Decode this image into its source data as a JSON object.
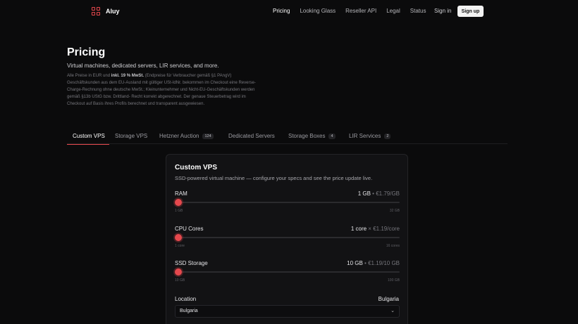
{
  "header": {
    "brand": "Aluy",
    "nav": [
      "Pricing",
      "Looking Glass",
      "Reseller API",
      "Legal",
      "Status"
    ],
    "active_nav": "Pricing",
    "signin": "Sign in",
    "signup": "Sign up"
  },
  "hero": {
    "title": "Pricing",
    "subtitle": "Virtual machines, dedicated servers, LIR services, and more.",
    "vat_prefix": "Alle Preise in EUR und ",
    "vat_bold": "inkl. 19 % MwSt.",
    "vat_rest": " (Endpreise für Verbraucher gemäß §1 PAngV) Geschäftskunden aus dem EU-Ausland mit gültiger USt-IdNr. bekommen im Checkout eine Reverse-Charge-Rechnung ohne deutsche MwSt.; Kleinunternehmer und Nicht-EU-Geschäftskunden werden gemäß §13b UStG bzw. Drittland- Recht korrekt abgerechnet. Der genaue Steuerbetrag wird im Checkout auf Basis ihres Profils berechnet und transparent ausgewiesen."
  },
  "tabs": [
    {
      "label": "Custom VPS",
      "count": ""
    },
    {
      "label": "Storage VPS",
      "count": ""
    },
    {
      "label": "Hetzner Auction",
      "count": "124"
    },
    {
      "label": "Dedicated Servers",
      "count": ""
    },
    {
      "label": "Storage Boxes",
      "count": "4"
    },
    {
      "label": "LIR Services",
      "count": "2"
    }
  ],
  "card": {
    "title": "Custom VPS",
    "subtitle": "SSD-powered virtual machine — configure your specs and see the price update live.",
    "ram": {
      "label": "RAM",
      "value": "1 GB",
      "price": " • €1.79/GB",
      "min": "1 GB",
      "max": "32 GB",
      "level": 0
    },
    "cpu": {
      "label": "CPU Cores",
      "value": "1 core",
      "price": " × €1.19/core",
      "min": "1 core",
      "max": "16 cores",
      "level": 0
    },
    "ssd": {
      "label": "SSD Storage",
      "value": "10 GB",
      "price": " • €1.19/10 GB",
      "min": "10 GB",
      "max": "100 GB",
      "level": 0
    },
    "location": {
      "label": "Location",
      "value": "Bulgaria",
      "selected": "Bulgaria"
    }
  },
  "colors": {
    "accent": "#e5484d",
    "background": "#0b0b0c",
    "card": "#121214"
  }
}
